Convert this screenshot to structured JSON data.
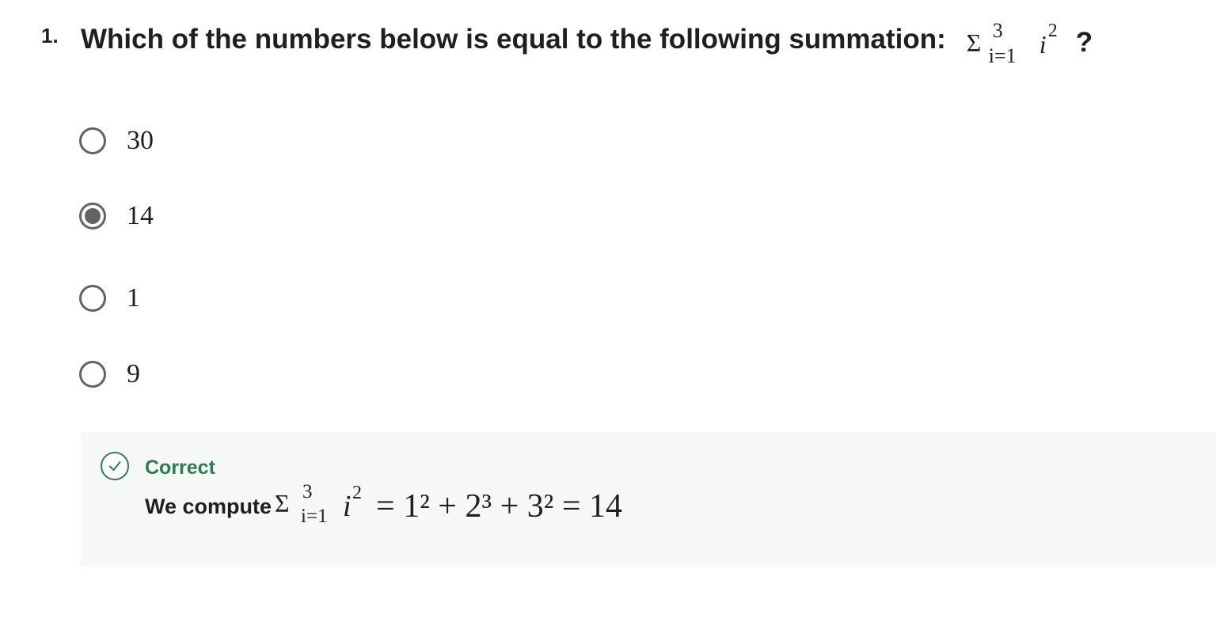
{
  "question": {
    "number": "1.",
    "text": "Which of the numbers below is equal to the following summation:",
    "formula": {
      "sigma": "Σ",
      "upper": "3",
      "lower": "i=1",
      "variable": "i",
      "exponent": "2",
      "trailing": "?"
    }
  },
  "options": [
    {
      "label": "30",
      "selected": false
    },
    {
      "label": "14",
      "selected": true
    },
    {
      "label": "1",
      "selected": false
    },
    {
      "label": "9",
      "selected": false
    }
  ],
  "feedback": {
    "status": "Correct",
    "status_color": "#2e7d4f",
    "icon": "check-circle-icon",
    "explanation_lead": "We compute",
    "formula": {
      "sigma": "Σ",
      "upper": "3",
      "lower": "i=1",
      "variable": "i",
      "exponent": "2",
      "rest": "= 1² + 2³ + 3² = 14"
    }
  }
}
